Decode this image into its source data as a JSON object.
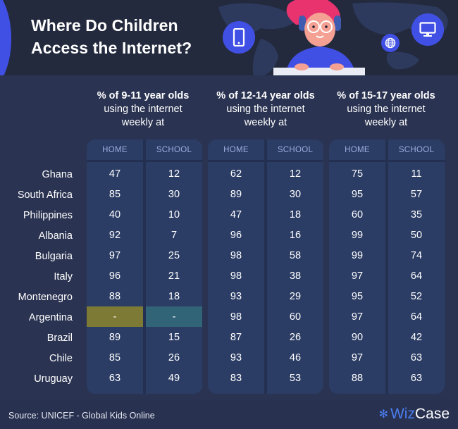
{
  "header": {
    "title_line1": "Where Do Children",
    "title_line2": "Access the Internet?",
    "icons": [
      "smartphone-icon",
      "globe-icon",
      "monitor-icon"
    ]
  },
  "colors": {
    "background": "#2a3351",
    "hero_background": "#232a3e",
    "accent_blue": "#4150e4",
    "column_fill": "#2c3d65",
    "column_header_text": "#9aaedf",
    "missing_home": "#7c7a35",
    "missing_school": "#326478",
    "brand_blue": "#4b7df0"
  },
  "groups": [
    {
      "title_bold": "% of 9-11 year olds",
      "title_rest_1": "using the internet",
      "title_rest_2": "weekly at",
      "home_label": "HOME",
      "school_label": "SCHOOL"
    },
    {
      "title_bold": "% of 12-14 year olds",
      "title_rest_1": "using the internet",
      "title_rest_2": "weekly at",
      "home_label": "HOME",
      "school_label": "SCHOOL"
    },
    {
      "title_bold": "% of 15-17 year olds",
      "title_rest_1": "using the internet",
      "title_rest_2": "weekly at",
      "home_label": "HOME",
      "school_label": "SCHOOL"
    }
  ],
  "countries": [
    "Ghana",
    "South Africa",
    "Philippines",
    "Albania",
    "Bulgaria",
    "Italy",
    "Montenegro",
    "Argentina",
    "Brazil",
    "Chile",
    "Uruguay"
  ],
  "chart_data": {
    "type": "table",
    "title": "Where Do Children Access the Internet?",
    "row_headers": [
      "Ghana",
      "South Africa",
      "Philippines",
      "Albania",
      "Bulgaria",
      "Italy",
      "Montenegro",
      "Argentina",
      "Brazil",
      "Chile",
      "Uruguay"
    ],
    "column_groups": [
      "% of 9-11 year olds using the internet weekly at",
      "% of 12-14 year olds using the internet weekly at",
      "% of 15-17 year olds using the internet weekly at"
    ],
    "columns": [
      "HOME",
      "SCHOOL"
    ],
    "series": [
      {
        "name": "9-11 HOME",
        "values": [
          "47",
          "85",
          "40",
          "92",
          "97",
          "96",
          "88",
          "-",
          "89",
          "85",
          "63"
        ]
      },
      {
        "name": "9-11 SCHOOL",
        "values": [
          "12",
          "30",
          "10",
          "7",
          "25",
          "21",
          "18",
          "-",
          "15",
          "26",
          "49"
        ]
      },
      {
        "name": "12-14 HOME",
        "values": [
          "62",
          "89",
          "47",
          "96",
          "98",
          "98",
          "93",
          "98",
          "87",
          "93",
          "83"
        ]
      },
      {
        "name": "12-14 SCHOOL",
        "values": [
          "12",
          "30",
          "18",
          "16",
          "58",
          "38",
          "29",
          "60",
          "26",
          "46",
          "53"
        ]
      },
      {
        "name": "15-17 HOME",
        "values": [
          "75",
          "95",
          "60",
          "99",
          "99",
          "97",
          "95",
          "97",
          "90",
          "97",
          "88"
        ]
      },
      {
        "name": "15-17 SCHOOL",
        "values": [
          "11",
          "57",
          "35",
          "50",
          "74",
          "64",
          "52",
          "64",
          "42",
          "63",
          "63"
        ]
      }
    ]
  },
  "footer": {
    "source": "Source: UNICEF - Global Kids Online",
    "brand_part1": "Wiz",
    "brand_part2": "Case",
    "brand_icon": "sparkle-icon"
  }
}
